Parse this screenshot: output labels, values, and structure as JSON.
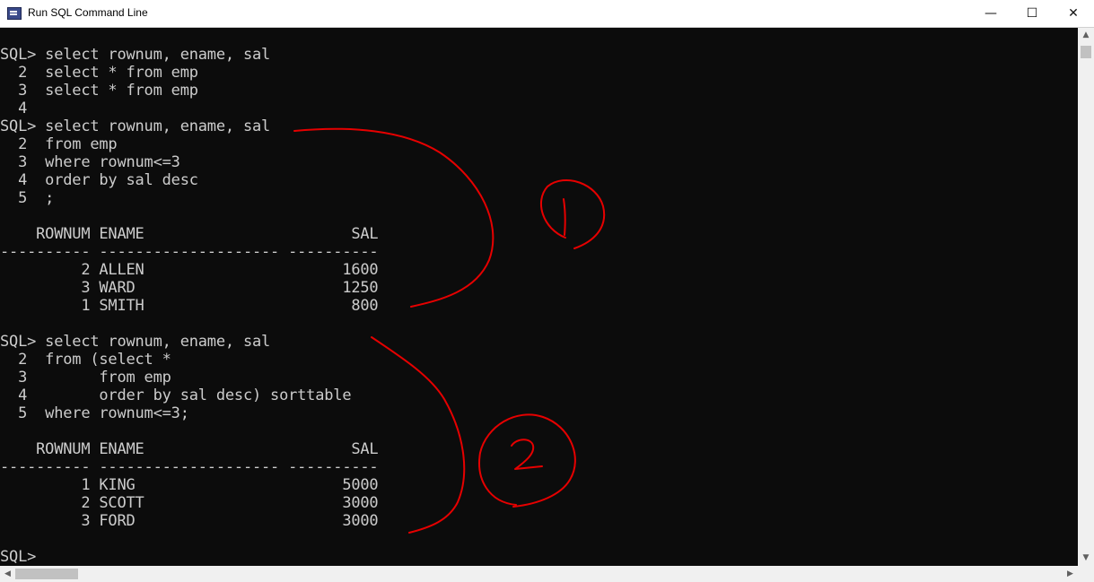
{
  "window": {
    "title": "Run SQL Command Line",
    "minimize_glyph": "—",
    "maximize_glyph": "☐",
    "close_glyph": "✕"
  },
  "console": {
    "lines": [
      "SQL> select rownum, ename, sal",
      "  2  select * from emp",
      "  3  select * from emp",
      "  4",
      "SQL> select rownum, ename, sal",
      "  2  from emp",
      "  3  where rownum<=3",
      "  4  order by sal desc",
      "  5  ;",
      "",
      "    ROWNUM ENAME                       SAL",
      "---------- -------------------- ----------",
      "         2 ALLEN                      1600",
      "         3 WARD                       1250",
      "         1 SMITH                       800",
      "",
      "SQL> select rownum, ename, sal",
      "  2  from (select *",
      "  3        from emp",
      "  4        order by sal desc) sorttable",
      "  5  where rownum<=3;",
      "",
      "    ROWNUM ENAME                       SAL",
      "---------- -------------------- ----------",
      "         1 KING                       5000",
      "         2 SCOTT                      3000",
      "         3 FORD                       3000",
      "",
      "SQL>"
    ]
  },
  "annotations": {
    "marker_1": "1",
    "marker_2": "2",
    "ink_color": "#e60000"
  },
  "scrollbars": {
    "up_glyph": "▲",
    "down_glyph": "▼",
    "left_glyph": "◀",
    "right_glyph": "▶"
  }
}
